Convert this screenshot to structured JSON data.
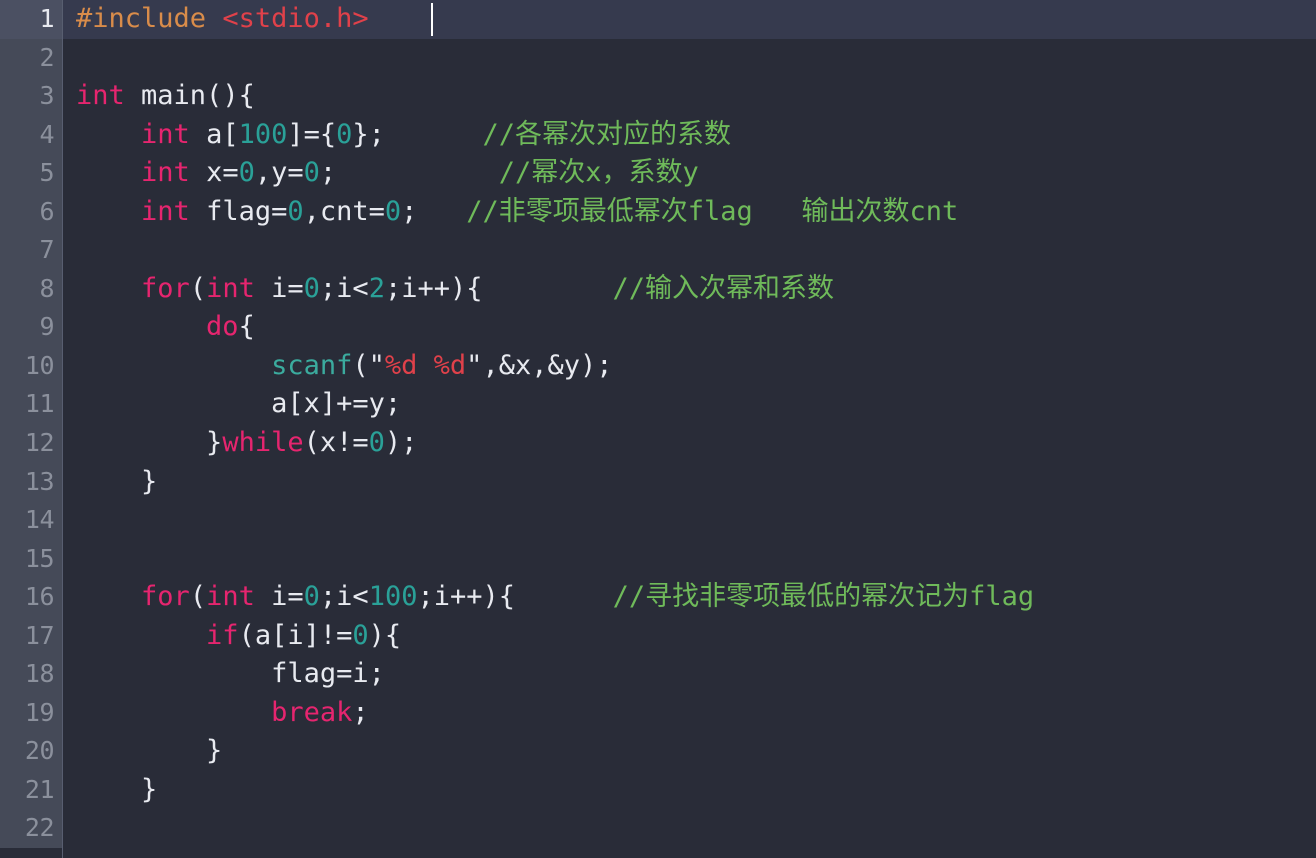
{
  "editor": {
    "theme_name": "dark",
    "language": "c",
    "colors": {
      "background": "#292c38",
      "active_line_background": "#363a4e",
      "gutter_background": "#454a58",
      "gutter_text": "#8b909c",
      "gutter_text_active": "#e8eaf0",
      "foreground": "#e8eaf0",
      "keyword": "#e6256f",
      "number": "#2aa198",
      "string": "#e0414a",
      "function": "#3bab9e",
      "comment": "#6fba5a",
      "preprocessor": "#d98c4a",
      "include_path": "#e0414a",
      "caret": "#ffffff"
    },
    "caret": {
      "line": 1,
      "column": 19
    },
    "lines": [
      {
        "number": "1",
        "active": true,
        "tokens": [
          {
            "text": "#include ",
            "cls": "t-pre"
          },
          {
            "text": "<stdio.h>",
            "cls": "t-inc"
          }
        ]
      },
      {
        "number": "2",
        "active": false,
        "tokens": []
      },
      {
        "number": "3",
        "active": false,
        "tokens": [
          {
            "text": "int",
            "cls": "t-kw"
          },
          {
            "text": " main(){",
            "cls": "t-plain"
          }
        ]
      },
      {
        "number": "4",
        "active": false,
        "tokens": [
          {
            "text": "    ",
            "cls": "t-plain"
          },
          {
            "text": "int",
            "cls": "t-kw"
          },
          {
            "text": " a[",
            "cls": "t-plain"
          },
          {
            "text": "100",
            "cls": "t-num"
          },
          {
            "text": "]={",
            "cls": "t-plain"
          },
          {
            "text": "0",
            "cls": "t-num"
          },
          {
            "text": "};",
            "cls": "t-plain"
          },
          {
            "text": "      ",
            "cls": "t-plain"
          },
          {
            "text": "//各幂次对应的系数",
            "cls": "t-cmt"
          }
        ]
      },
      {
        "number": "5",
        "active": false,
        "tokens": [
          {
            "text": "    ",
            "cls": "t-plain"
          },
          {
            "text": "int",
            "cls": "t-kw"
          },
          {
            "text": " x=",
            "cls": "t-plain"
          },
          {
            "text": "0",
            "cls": "t-num"
          },
          {
            "text": ",y=",
            "cls": "t-plain"
          },
          {
            "text": "0",
            "cls": "t-num"
          },
          {
            "text": ";",
            "cls": "t-plain"
          },
          {
            "text": "          ",
            "cls": "t-plain"
          },
          {
            "text": "//幂次x，系数y",
            "cls": "t-cmt"
          }
        ]
      },
      {
        "number": "6",
        "active": false,
        "tokens": [
          {
            "text": "    ",
            "cls": "t-plain"
          },
          {
            "text": "int",
            "cls": "t-kw"
          },
          {
            "text": " flag=",
            "cls": "t-plain"
          },
          {
            "text": "0",
            "cls": "t-num"
          },
          {
            "text": ",cnt=",
            "cls": "t-plain"
          },
          {
            "text": "0",
            "cls": "t-num"
          },
          {
            "text": ";",
            "cls": "t-plain"
          },
          {
            "text": "   ",
            "cls": "t-plain"
          },
          {
            "text": "//非零项最低幂次flag   输出次数cnt",
            "cls": "t-cmt"
          }
        ]
      },
      {
        "number": "7",
        "active": false,
        "tokens": []
      },
      {
        "number": "8",
        "active": false,
        "tokens": [
          {
            "text": "    ",
            "cls": "t-plain"
          },
          {
            "text": "for",
            "cls": "t-kw"
          },
          {
            "text": "(",
            "cls": "t-plain"
          },
          {
            "text": "int",
            "cls": "t-kw"
          },
          {
            "text": " i=",
            "cls": "t-plain"
          },
          {
            "text": "0",
            "cls": "t-num"
          },
          {
            "text": ";i<",
            "cls": "t-plain"
          },
          {
            "text": "2",
            "cls": "t-num"
          },
          {
            "text": ";i++){",
            "cls": "t-plain"
          },
          {
            "text": "        ",
            "cls": "t-plain"
          },
          {
            "text": "//输入次幂和系数",
            "cls": "t-cmt"
          }
        ]
      },
      {
        "number": "9",
        "active": false,
        "tokens": [
          {
            "text": "        ",
            "cls": "t-plain"
          },
          {
            "text": "do",
            "cls": "t-kw"
          },
          {
            "text": "{",
            "cls": "t-plain"
          }
        ]
      },
      {
        "number": "10",
        "active": false,
        "tokens": [
          {
            "text": "            ",
            "cls": "t-plain"
          },
          {
            "text": "scanf",
            "cls": "t-fn"
          },
          {
            "text": "(",
            "cls": "t-plain"
          },
          {
            "text": "\"",
            "cls": "t-quote"
          },
          {
            "text": "%d %d",
            "cls": "t-str"
          },
          {
            "text": "\"",
            "cls": "t-quote"
          },
          {
            "text": ",&x,&y);",
            "cls": "t-plain"
          }
        ]
      },
      {
        "number": "11",
        "active": false,
        "tokens": [
          {
            "text": "            a[x]+=y;",
            "cls": "t-plain"
          }
        ]
      },
      {
        "number": "12",
        "active": false,
        "tokens": [
          {
            "text": "        }",
            "cls": "t-plain"
          },
          {
            "text": "while",
            "cls": "t-kw"
          },
          {
            "text": "(x!=",
            "cls": "t-plain"
          },
          {
            "text": "0",
            "cls": "t-num"
          },
          {
            "text": ");",
            "cls": "t-plain"
          }
        ]
      },
      {
        "number": "13",
        "active": false,
        "tokens": [
          {
            "text": "    }",
            "cls": "t-plain"
          }
        ]
      },
      {
        "number": "14",
        "active": false,
        "tokens": []
      },
      {
        "number": "15",
        "active": false,
        "tokens": []
      },
      {
        "number": "16",
        "active": false,
        "tokens": [
          {
            "text": "    ",
            "cls": "t-plain"
          },
          {
            "text": "for",
            "cls": "t-kw"
          },
          {
            "text": "(",
            "cls": "t-plain"
          },
          {
            "text": "int",
            "cls": "t-kw"
          },
          {
            "text": " i=",
            "cls": "t-plain"
          },
          {
            "text": "0",
            "cls": "t-num"
          },
          {
            "text": ";i<",
            "cls": "t-plain"
          },
          {
            "text": "100",
            "cls": "t-num"
          },
          {
            "text": ";i++){",
            "cls": "t-plain"
          },
          {
            "text": "      ",
            "cls": "t-plain"
          },
          {
            "text": "//寻找非零项最低的幂次记为flag",
            "cls": "t-cmt"
          }
        ]
      },
      {
        "number": "17",
        "active": false,
        "tokens": [
          {
            "text": "        ",
            "cls": "t-plain"
          },
          {
            "text": "if",
            "cls": "t-kw"
          },
          {
            "text": "(a[i]!=",
            "cls": "t-plain"
          },
          {
            "text": "0",
            "cls": "t-num"
          },
          {
            "text": "){",
            "cls": "t-plain"
          }
        ]
      },
      {
        "number": "18",
        "active": false,
        "tokens": [
          {
            "text": "            flag=i;",
            "cls": "t-plain"
          }
        ]
      },
      {
        "number": "19",
        "active": false,
        "tokens": [
          {
            "text": "            ",
            "cls": "t-plain"
          },
          {
            "text": "break",
            "cls": "t-kw"
          },
          {
            "text": ";",
            "cls": "t-plain"
          }
        ]
      },
      {
        "number": "20",
        "active": false,
        "tokens": [
          {
            "text": "        }",
            "cls": "t-plain"
          }
        ]
      },
      {
        "number": "21",
        "active": false,
        "tokens": [
          {
            "text": "    }",
            "cls": "t-plain"
          }
        ]
      },
      {
        "number": "22",
        "active": false,
        "tokens": []
      }
    ]
  }
}
